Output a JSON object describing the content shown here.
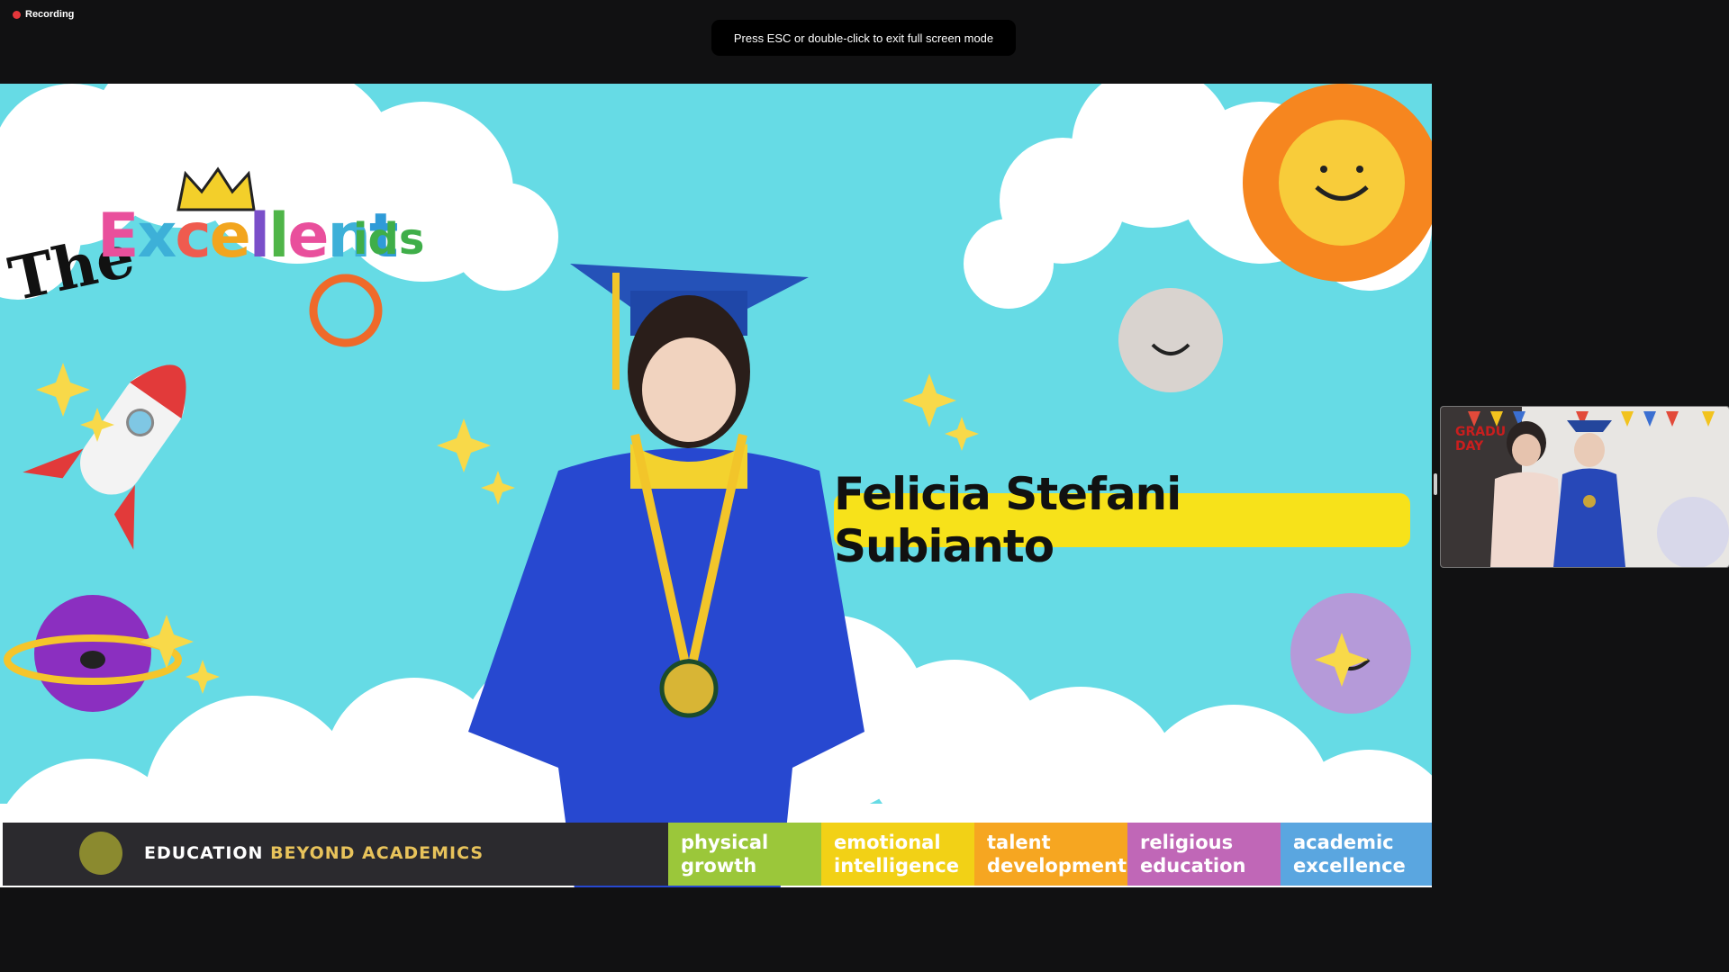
{
  "recording": {
    "label": "Recording",
    "dot_color": "#e5373b"
  },
  "fullscreen_toast": {
    "text": "Press ESC or double-click to exit full screen mode"
  },
  "slide": {
    "logo": {
      "the": "The",
      "excellent": "Excellent",
      "kids": "ids"
    },
    "student_name": "Felicia Stefani Subianto",
    "footer": {
      "tagline_main": "EDUCATION ",
      "tagline_accent": "BEYOND ACADEMICS",
      "pillars": [
        {
          "text": "physical\ngrowth",
          "color": "#9bc73a"
        },
        {
          "text": "emotional\nintelligence",
          "color": "#f2d116"
        },
        {
          "text": "talent\ndevelopment",
          "color": "#f6a621"
        },
        {
          "text": "religious\neducation",
          "color": "#c067b7"
        },
        {
          "text": "academic\nexcellence",
          "color": "#5aa6e0"
        }
      ]
    },
    "background_color": "#66dbe5"
  },
  "self_view": {
    "banner_text": "GRADU DAY"
  }
}
